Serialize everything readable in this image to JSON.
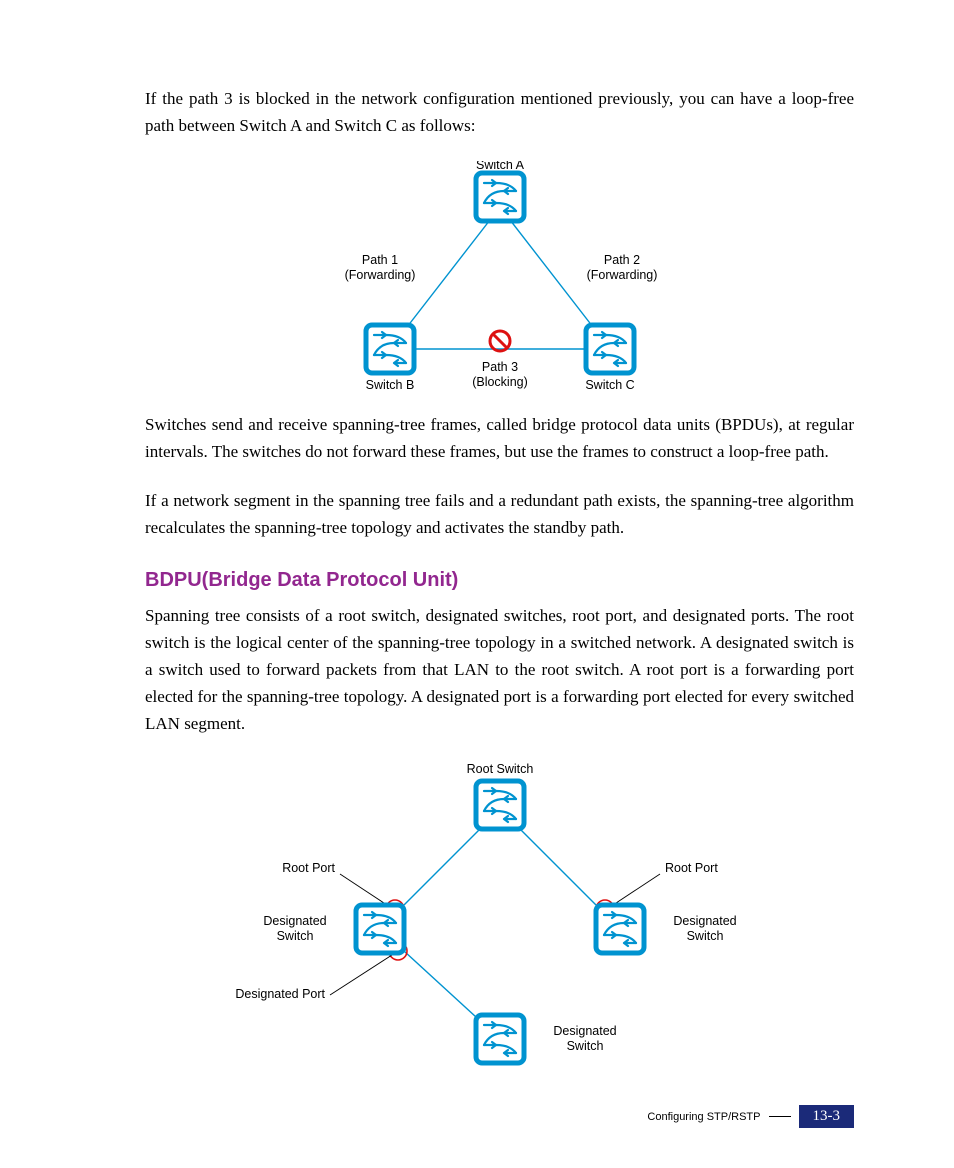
{
  "para1": "If the path 3 is blocked in the network configuration mentioned previously, you can have a loop-free path between Switch A and Switch C as follows:",
  "para2": "Switches send and receive spanning-tree frames, called bridge protocol data units (BPDUs), at regular intervals. The switches do not forward these frames, but use the frames to construct a loop-free path.",
  "para3": "If a network segment in the spanning tree fails and a redundant path exists, the spanning-tree algorithm recalculates the spanning-tree topology and activates the standby path.",
  "heading": "BDPU(Bridge Data Protocol Unit)",
  "para4": "Spanning tree consists of a root switch, designated switches, root port, and designated ports. The root switch is the logical center of the spanning-tree topology in a switched network. A designated switch is a switch used to forward packets from that LAN to the root switch. A root port is a forwarding port elected for the spanning-tree topology. A designated port is a forwarding port elected for every switched LAN segment.",
  "diagram1": {
    "switchA": "Switch A",
    "switchB": "Switch B",
    "switchC": "Switch C",
    "path1_a": "Path 1",
    "path1_b": "(Forwarding)",
    "path2_a": "Path 2",
    "path2_b": "(Forwarding)",
    "path3_a": "Path 3",
    "path3_b": "(Blocking)"
  },
  "diagram2": {
    "rootSwitch": "Root Switch",
    "rootPortL": "Root Port",
    "rootPortR": "Root Port",
    "desigSwitchL_a": "Designated",
    "desigSwitchL_b": "Switch",
    "desigSwitchR_a": "Designated",
    "desigSwitchR_b": "Switch",
    "desigPort": "Designated Port",
    "desigSwitchB_a": "Designated",
    "desigSwitchB_b": "Switch"
  },
  "footer": {
    "label": "Configuring STP/RSTP",
    "page": "13-3"
  }
}
